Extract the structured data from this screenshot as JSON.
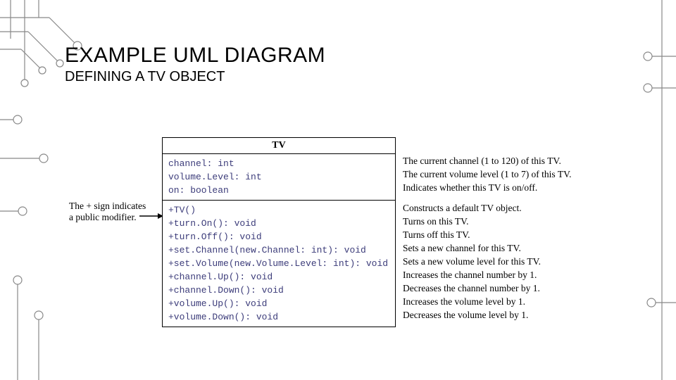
{
  "title": "EXAMPLE UML DIAGRAM",
  "subtitle": "DEFINING A TV OBJECT",
  "left_note_l1": "The + sign indicates",
  "left_note_l2": "a public modifier.",
  "class_name": "TV",
  "attributes": [
    {
      "sig": "channel: int",
      "desc": "The current channel (1 to 120) of this TV."
    },
    {
      "sig": "volume.Level: int",
      "desc": "The current volume level (1 to 7) of this TV."
    },
    {
      "sig": "on: boolean",
      "desc": "Indicates whether this TV is on/off."
    }
  ],
  "methods": [
    {
      "sig": "+TV()",
      "desc": "Constructs a default TV object."
    },
    {
      "sig": "+turn.On(): void",
      "desc": "Turns on this TV."
    },
    {
      "sig": "+turn.Off(): void",
      "desc": "Turns off this TV."
    },
    {
      "sig": "+set.Channel(new.Channel: int): void",
      "desc": "Sets a new channel for this TV."
    },
    {
      "sig": "+set.Volume(new.Volume.Level: int): void",
      "desc": "Sets a new volume level for this TV."
    },
    {
      "sig": "+channel.Up(): void",
      "desc": "Increases the channel number by 1."
    },
    {
      "sig": "+channel.Down(): void",
      "desc": "Decreases the channel number by 1."
    },
    {
      "sig": "+volume.Up(): void",
      "desc": "Increases the volume level by 1."
    },
    {
      "sig": "+volume.Down(): void",
      "desc": "Decreases the volume level by 1."
    }
  ]
}
